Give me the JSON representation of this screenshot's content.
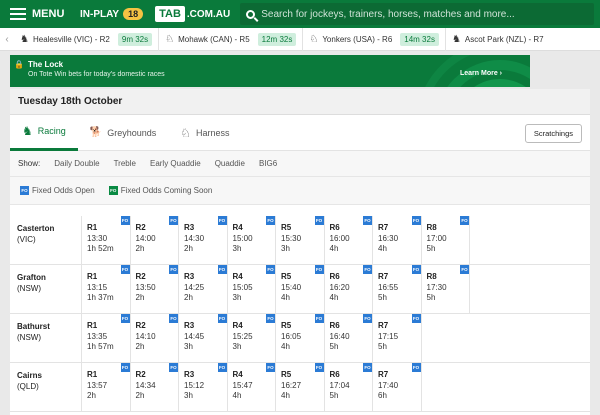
{
  "header": {
    "menu_label": "MENU",
    "inplay_label": "IN-PLAY",
    "inplay_count": "18",
    "logo_tab": "TAB",
    "logo_rest": ".COM.AU",
    "search_placeholder": "Search for jockeys, trainers, horses, matches and more..."
  },
  "next_to_go": [
    {
      "icon": "horse-icon",
      "glyph": "♞",
      "name": "Healesville (VIC) - R2",
      "time": "9m 32s"
    },
    {
      "icon": "harness-icon",
      "glyph": "♘",
      "name": "Mohawk (CAN) - R5",
      "time": "12m 32s"
    },
    {
      "icon": "harness-icon",
      "glyph": "♘",
      "name": "Yonkers (USA) - R6",
      "time": "14m 32s"
    },
    {
      "icon": "horse-icon",
      "glyph": "♞",
      "name": "Ascot Park (NZL) - R7",
      "time": ""
    }
  ],
  "banner": {
    "title": "The Lock",
    "subtitle": "On Tote Win bets for today's domestic races",
    "cta": "Learn More ›"
  },
  "date_header": "Tuesday 18th October",
  "tabs": [
    {
      "label": "Racing",
      "glyph": "♞",
      "active": true
    },
    {
      "label": "Greyhounds",
      "glyph": "🐕",
      "active": false
    },
    {
      "label": "Harness",
      "glyph": "♘",
      "active": false
    }
  ],
  "scratchings_label": "Scratchings",
  "show": {
    "label": "Show:",
    "options": [
      "Daily Double",
      "Treble",
      "Early Quaddie",
      "Quaddie",
      "BIG6"
    ]
  },
  "legend": {
    "fo_badge": "FO",
    "open_label": "Fixed Odds Open",
    "coming_label": "Fixed Odds Coming Soon"
  },
  "meetings": [
    {
      "venue": "Casterton",
      "state": "(VIC)",
      "races": [
        {
          "r": "R1",
          "time": "13:30",
          "countdown": "1h 52m",
          "fo": "open"
        },
        {
          "r": "R2",
          "time": "14:00",
          "countdown": "2h",
          "fo": "open"
        },
        {
          "r": "R3",
          "time": "14:30",
          "countdown": "2h",
          "fo": "open"
        },
        {
          "r": "R4",
          "time": "15:00",
          "countdown": "3h",
          "fo": "open"
        },
        {
          "r": "R5",
          "time": "15:30",
          "countdown": "3h",
          "fo": "open"
        },
        {
          "r": "R6",
          "time": "16:00",
          "countdown": "4h",
          "fo": "open"
        },
        {
          "r": "R7",
          "time": "16:30",
          "countdown": "4h",
          "fo": "open"
        },
        {
          "r": "R8",
          "time": "17:00",
          "countdown": "5h",
          "fo": "open"
        }
      ]
    },
    {
      "venue": "Grafton",
      "state": "(NSW)",
      "races": [
        {
          "r": "R1",
          "time": "13:15",
          "countdown": "1h 37m",
          "fo": "open"
        },
        {
          "r": "R2",
          "time": "13:50",
          "countdown": "2h",
          "fo": "open"
        },
        {
          "r": "R3",
          "time": "14:25",
          "countdown": "2h",
          "fo": "open"
        },
        {
          "r": "R4",
          "time": "15:05",
          "countdown": "3h",
          "fo": "open"
        },
        {
          "r": "R5",
          "time": "15:40",
          "countdown": "4h",
          "fo": "open"
        },
        {
          "r": "R6",
          "time": "16:20",
          "countdown": "4h",
          "fo": "open"
        },
        {
          "r": "R7",
          "time": "16:55",
          "countdown": "5h",
          "fo": "open"
        },
        {
          "r": "R8",
          "time": "17:30",
          "countdown": "5h",
          "fo": "open"
        }
      ]
    },
    {
      "venue": "Bathurst",
      "state": "(NSW)",
      "races": [
        {
          "r": "R1",
          "time": "13:35",
          "countdown": "1h 57m",
          "fo": "open"
        },
        {
          "r": "R2",
          "time": "14:10",
          "countdown": "2h",
          "fo": "open"
        },
        {
          "r": "R3",
          "time": "14:45",
          "countdown": "3h",
          "fo": "open"
        },
        {
          "r": "R4",
          "time": "15:25",
          "countdown": "3h",
          "fo": "open"
        },
        {
          "r": "R5",
          "time": "16:05",
          "countdown": "4h",
          "fo": "open"
        },
        {
          "r": "R6",
          "time": "16:40",
          "countdown": "5h",
          "fo": "open"
        },
        {
          "r": "R7",
          "time": "17:15",
          "countdown": "5h",
          "fo": "open"
        }
      ]
    },
    {
      "venue": "Cairns",
      "state": "(QLD)",
      "races": [
        {
          "r": "R1",
          "time": "13:57",
          "countdown": "2h",
          "fo": "open"
        },
        {
          "r": "R2",
          "time": "14:34",
          "countdown": "2h",
          "fo": "open"
        },
        {
          "r": "R3",
          "time": "15:12",
          "countdown": "3h",
          "fo": "open"
        },
        {
          "r": "R4",
          "time": "15:47",
          "countdown": "4h",
          "fo": "open"
        },
        {
          "r": "R5",
          "time": "16:27",
          "countdown": "4h",
          "fo": "open"
        },
        {
          "r": "R6",
          "time": "17:04",
          "countdown": "5h",
          "fo": "open"
        },
        {
          "r": "R7",
          "time": "17:40",
          "countdown": "6h",
          "fo": "open"
        }
      ]
    }
  ],
  "colors": {
    "brand_green": "#0a7a3b",
    "fo_open": "#2b7bd5",
    "fo_coming": "#0a8a43",
    "inplay_badge": "#f6c343"
  }
}
